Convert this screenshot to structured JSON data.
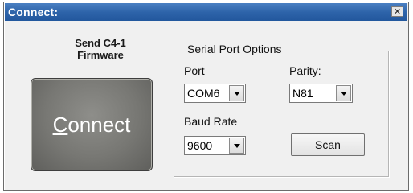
{
  "window": {
    "title": "Connect:",
    "close_glyph": "✕"
  },
  "firmware_label": "Send C4-1\nFirmware",
  "connect_button": {
    "mnemonic": "C",
    "rest": "onnect"
  },
  "serial_port_options": {
    "legend": "Serial Port Options",
    "port_label": "Port",
    "port_value": "COM6",
    "parity_label": "Parity:",
    "parity_value": "N81",
    "baud_label": "Baud Rate",
    "baud_value": "9600",
    "scan_label": "Scan"
  },
  "colors": {
    "title_bar": "#2e64aa",
    "connect_button_bg": "#777773",
    "dialog_bg": "#f0f0f0"
  },
  "icons": {
    "close": "close-icon",
    "dropdown": "chevron-down-icon"
  }
}
